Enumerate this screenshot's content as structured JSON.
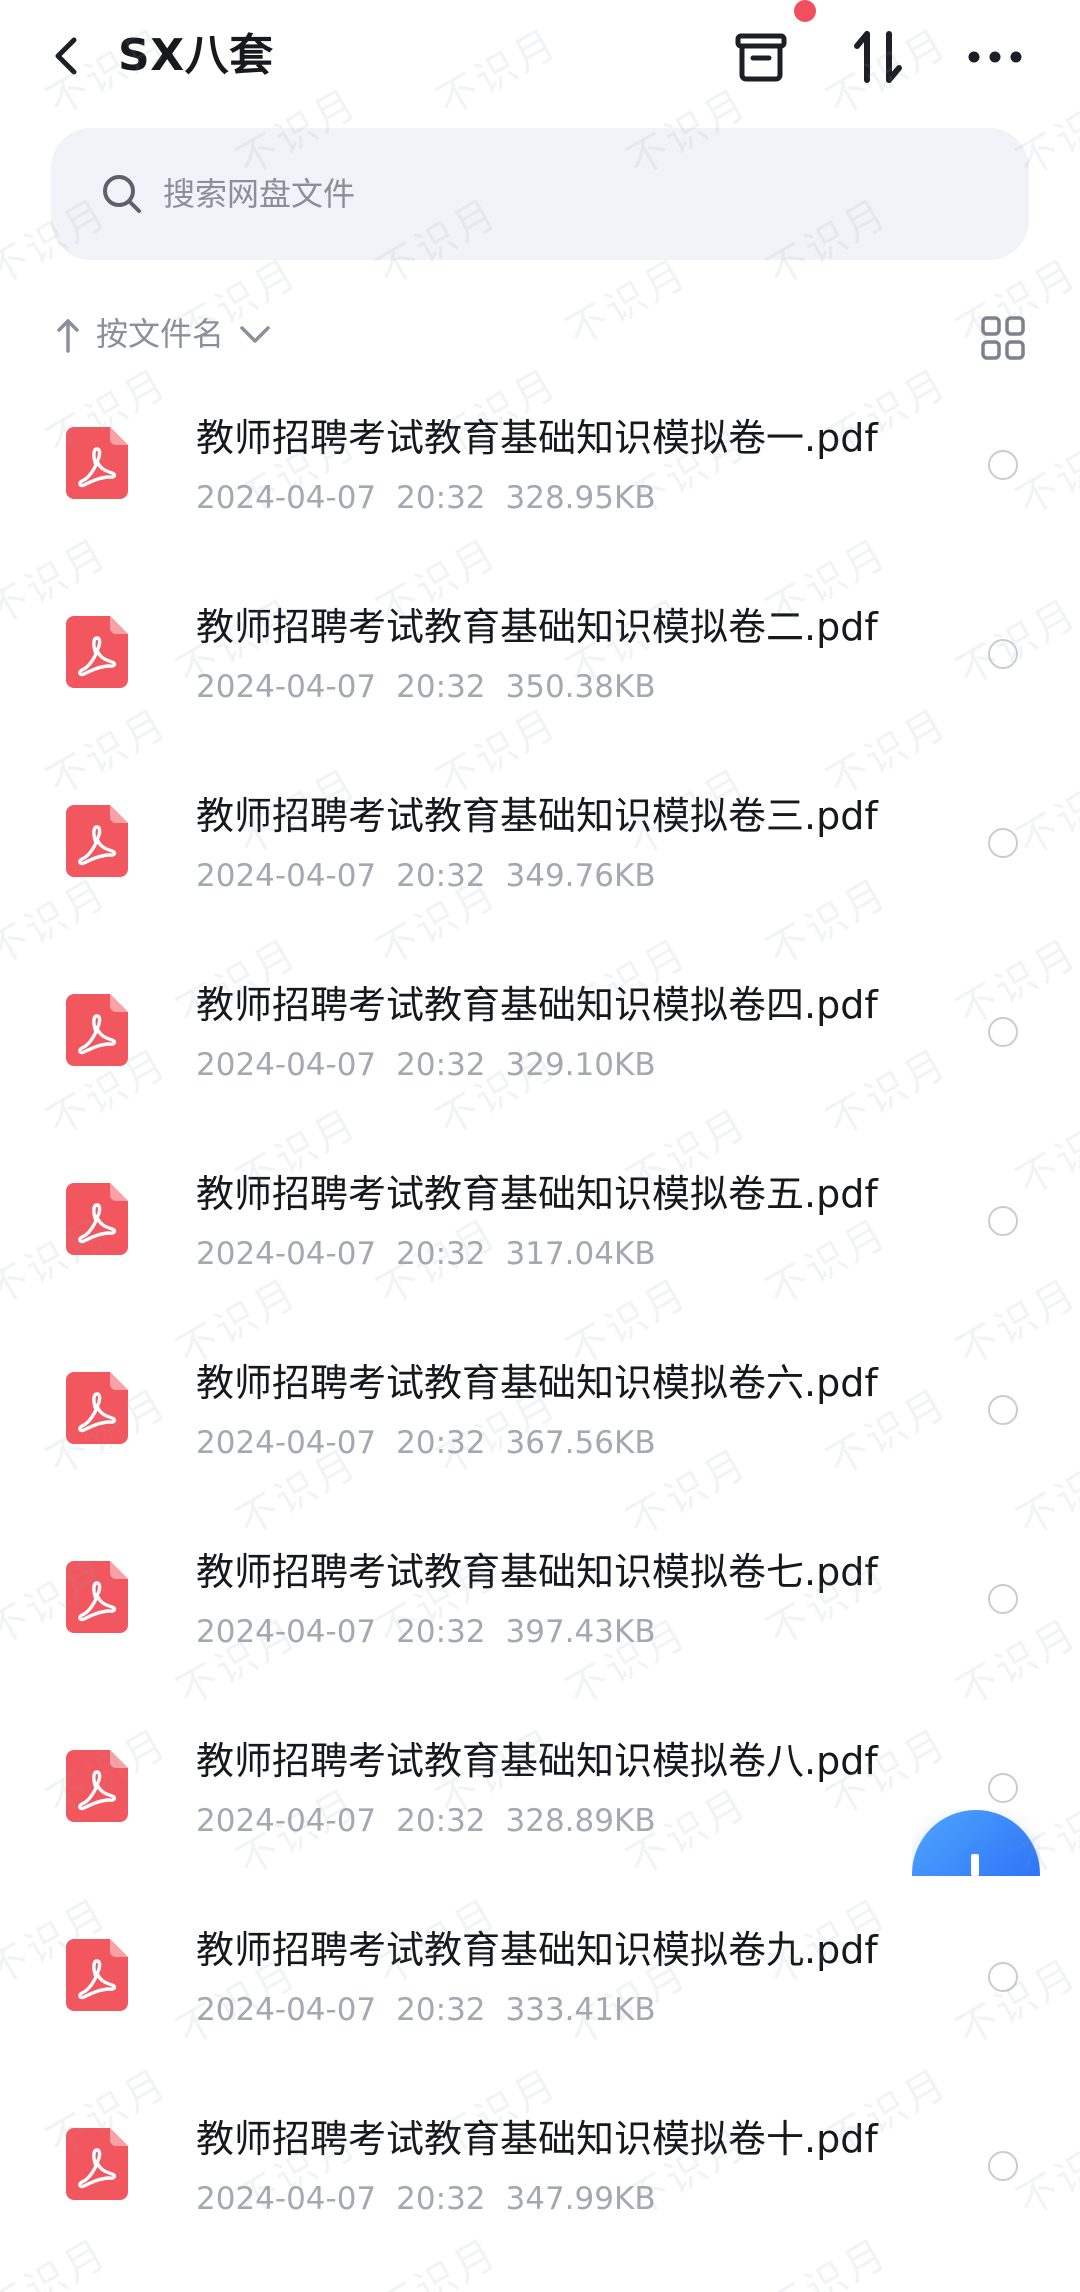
{
  "header": {
    "back_icon": "chevron-left-icon",
    "title": "SX八套",
    "actions": [
      "archive-box-icon",
      "sort-arrows-icon",
      "more-dots-icon"
    ],
    "notification_dot_color": "#f24e5e"
  },
  "search": {
    "icon": "search-icon",
    "placeholder": "搜索网盘文件"
  },
  "sortbar": {
    "direction_icon": "arrow-up-icon",
    "label": "按文件名",
    "chevron_icon": "chevron-down-icon",
    "view_toggle_icon": "grid-view-icon"
  },
  "files": [
    {
      "name": "教师招聘考试教育基础知识模拟卷一.pdf",
      "date": "2024-04-07",
      "time": "20:32",
      "size": "328.95KB"
    },
    {
      "name": "教师招聘考试教育基础知识模拟卷二.pdf",
      "date": "2024-04-07",
      "time": "20:32",
      "size": "350.38KB"
    },
    {
      "name": "教师招聘考试教育基础知识模拟卷三.pdf",
      "date": "2024-04-07",
      "time": "20:32",
      "size": "349.76KB"
    },
    {
      "name": "教师招聘考试教育基础知识模拟卷四.pdf",
      "date": "2024-04-07",
      "time": "20:32",
      "size": "329.10KB"
    },
    {
      "name": "教师招聘考试教育基础知识模拟卷五.pdf",
      "date": "2024-04-07",
      "time": "20:32",
      "size": "317.04KB"
    },
    {
      "name": "教师招聘考试教育基础知识模拟卷六.pdf",
      "date": "2024-04-07",
      "time": "20:32",
      "size": "367.56KB"
    },
    {
      "name": "教师招聘考试教育基础知识模拟卷七.pdf",
      "date": "2024-04-07",
      "time": "20:32",
      "size": "397.43KB"
    },
    {
      "name": "教师招聘考试教育基础知识模拟卷八.pdf",
      "date": "2024-04-07",
      "time": "20:32",
      "size": "328.89KB"
    },
    {
      "name": "教师招聘考试教育基础知识模拟卷九.pdf",
      "date": "2024-04-07",
      "time": "20:32",
      "size": "333.41KB"
    },
    {
      "name": "教师招聘考试教育基础知识模拟卷十.pdf",
      "date": "2024-04-07",
      "time": "20:32",
      "size": "347.99KB"
    }
  ],
  "file_icon": "pdf-file-icon",
  "colors": {
    "pdf_icon": "#f2575f",
    "accent": "#2f7bff"
  },
  "watermark": "不识月"
}
